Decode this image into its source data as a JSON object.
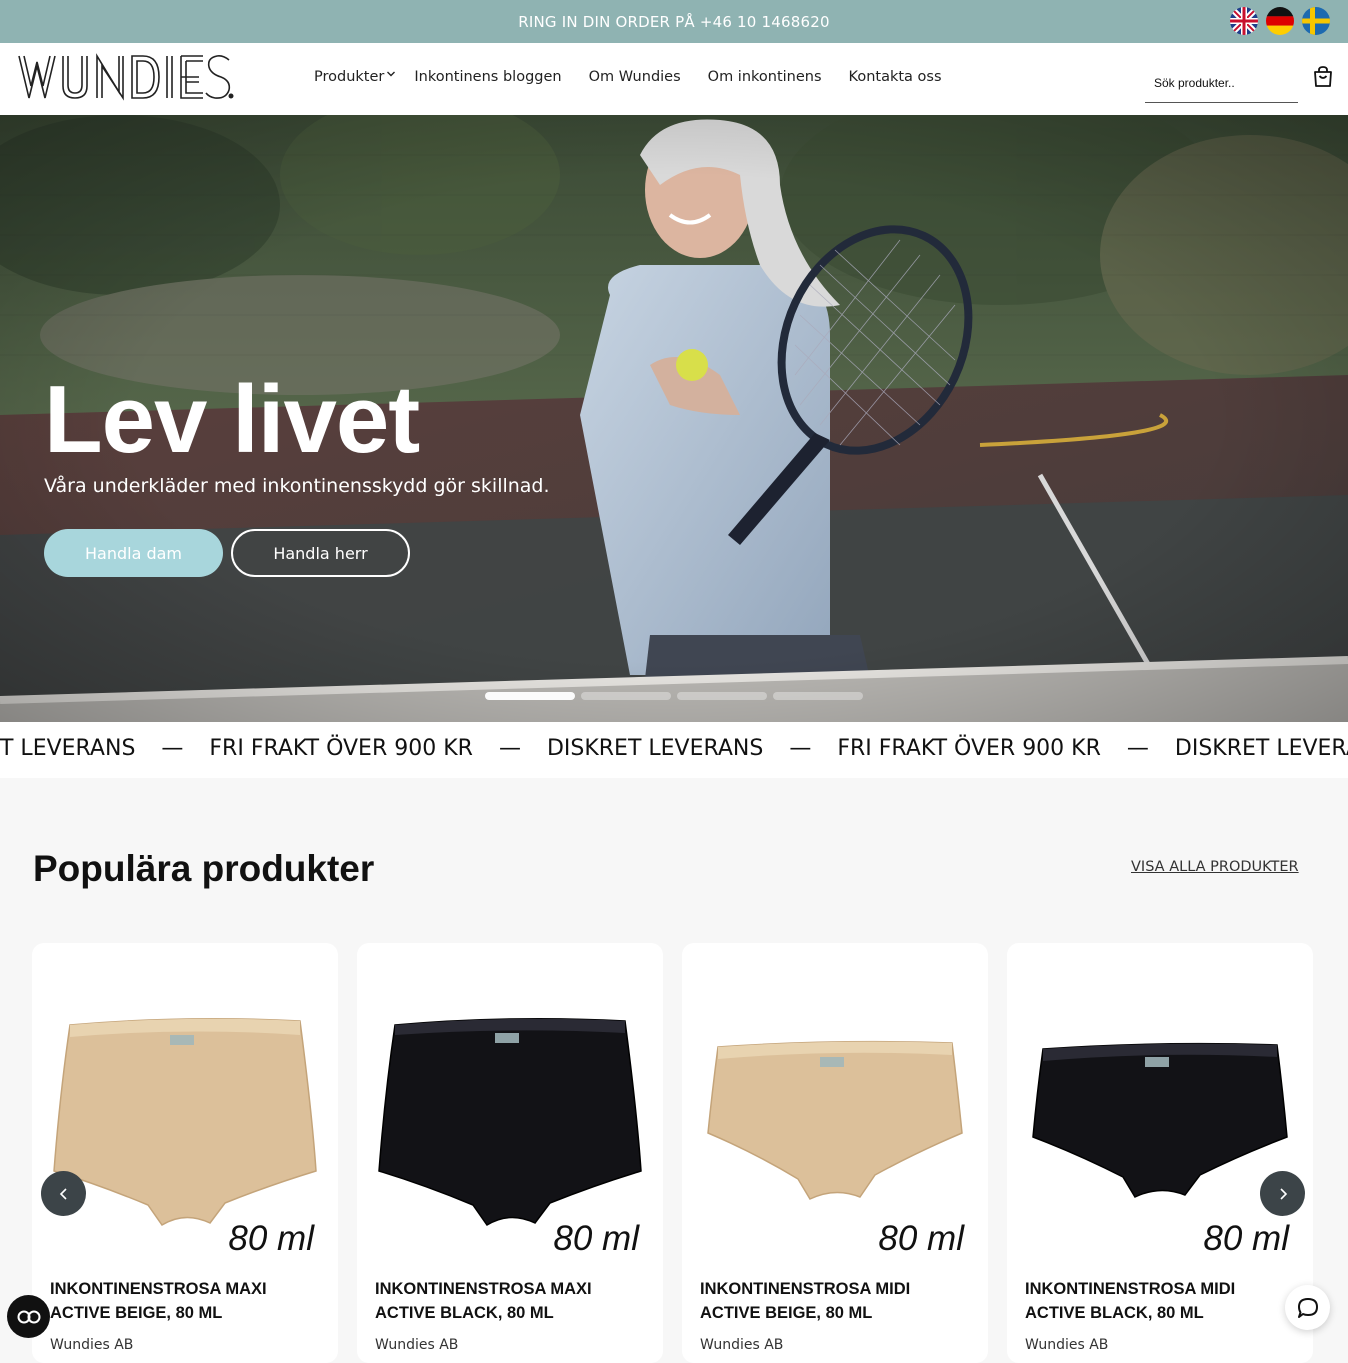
{
  "topbar": {
    "announcement": "RING IN DIN ORDER PÅ +46 10 1468620",
    "languages": [
      "english-flag",
      "german-flag",
      "swedish-flag"
    ]
  },
  "header": {
    "logo_text": "WUNDIES.",
    "nav": [
      {
        "label": "Produkter",
        "has_dropdown": true
      },
      {
        "label": "Inkontinens bloggen"
      },
      {
        "label": "Om Wundies"
      },
      {
        "label": "Om inkontinens"
      },
      {
        "label": "Kontakta oss"
      }
    ],
    "search_placeholder": "Sök produkter..",
    "cart_icon": "cart-icon"
  },
  "hero": {
    "title": "Lev livet",
    "subtitle": "Våra underkläder med inkontinensskydd gör skillnad.",
    "button_primary": "Handla dam",
    "button_secondary": "Handla herr",
    "slide_count": 4,
    "active_slide": 1
  },
  "marquee": {
    "items": [
      "DISKRET LEVERANS",
      "FRI FRAKT ÖVER 900 KR",
      "DISKRET LEVERANS",
      "FRI FRAKT ÖVER 900 KR",
      "DISKRET LEVERANS"
    ],
    "first_visible_fragment": "T LEVERANS",
    "separator": "—"
  },
  "popular": {
    "title": "Populära produkter",
    "see_all": "VISA ALLA PRODUKTER",
    "products": [
      {
        "volume": "80 ml",
        "name": "INKONTINENSTROSA MAXI ACTIVE BEIGE, 80 ML",
        "brand": "Wundies AB",
        "color": "beige",
        "cut": "maxi"
      },
      {
        "volume": "80 ml",
        "name": "INKONTINENSTROSA MAXI ACTIVE BLACK, 80 ML",
        "brand": "Wundies AB",
        "color": "black",
        "cut": "maxi"
      },
      {
        "volume": "80 ml",
        "name": "INKONTINENSTROSA MIDI ACTIVE BEIGE, 80 ML",
        "brand": "Wundies AB",
        "color": "beige",
        "cut": "midi"
      },
      {
        "volume": "80 ml",
        "name": "INKONTINENSTROSA MIDI ACTIVE BLACK, 80 ML",
        "brand": "Wundies AB",
        "color": "black",
        "cut": "midi"
      }
    ]
  },
  "colors": {
    "topbar": "#8fb3b2",
    "primary_button": "#a8d6dc",
    "arrow_button": "#3c4448"
  }
}
